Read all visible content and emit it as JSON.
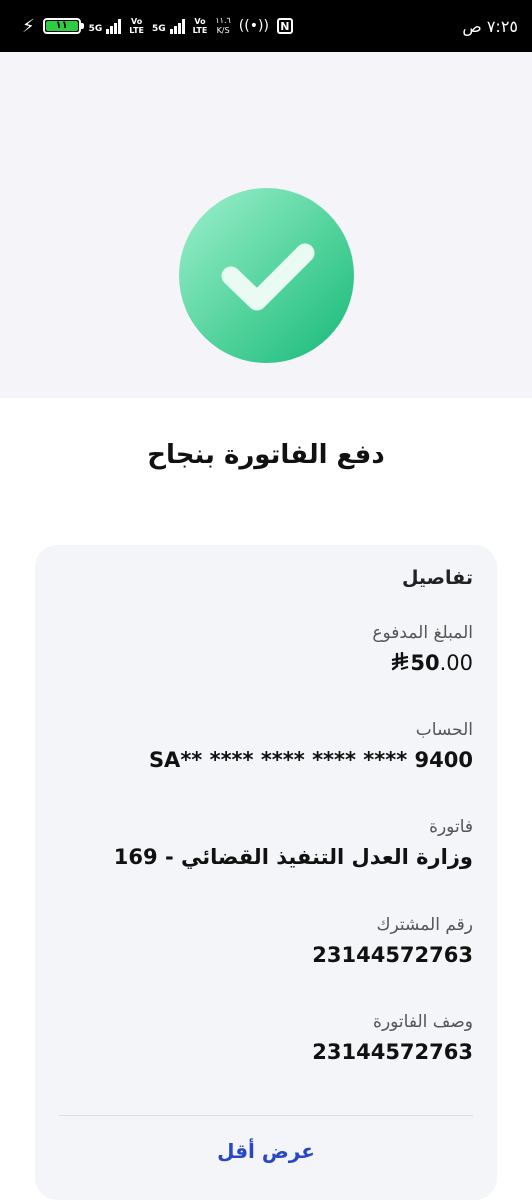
{
  "status_bar": {
    "time": "٧:٢٥ ص",
    "battery_level": "١١",
    "sim1_tech": "5G",
    "sim1_volte": "Vo\nLTE",
    "sim2_tech": "5G",
    "sim2_volte": "Vo\nLTE",
    "net_speed_value": "١١.٦",
    "net_speed_unit": "K/S",
    "nfc_label": "N"
  },
  "success": {
    "title": "دفع الفاتورة بنجاح",
    "accent_color": "#2ecf8c"
  },
  "details": {
    "heading": "تفاصيل",
    "amount": {
      "label": "المبلغ المدفوع",
      "integer": "50",
      "decimal": ".00"
    },
    "account": {
      "label": "الحساب",
      "value": "SA** **** **** **** **** 9400"
    },
    "bill": {
      "label": "فاتورة",
      "value": "169 - وزارة العدل التنفيذ القضائي"
    },
    "subscriber": {
      "label": "رقم المشترك",
      "value": "23144572763"
    },
    "bill_description": {
      "label": "وصف الفاتورة",
      "value": "23144572763"
    },
    "show_less_label": "عرض أقل",
    "link_color": "#2847c7"
  }
}
